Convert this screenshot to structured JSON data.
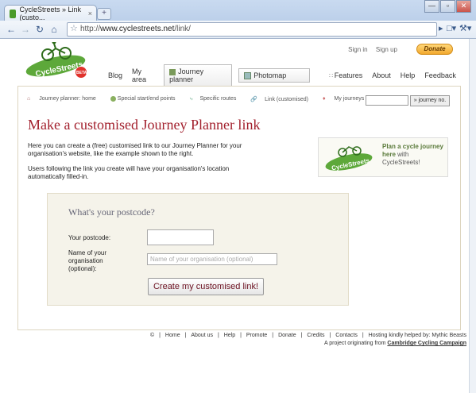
{
  "browser": {
    "tab_title": "CycleStreets » Link (custo...",
    "tab_close": "×",
    "new_tab": "+",
    "window_buttons": [
      "—",
      "▫",
      "✕"
    ],
    "url_prefix": "http://",
    "url_host": "www.cyclestreets.net",
    "url_path": "/link/"
  },
  "header": {
    "logo_text": "CycleStreets",
    "logo_badge": "BETA",
    "signin": "Sign in",
    "signup": "Sign up",
    "donate": "Donate",
    "nav": [
      "Blog",
      "My area",
      "Journey planner",
      "Photomap",
      "Features",
      "About",
      "Help",
      "Feedback"
    ]
  },
  "subnav": {
    "items": [
      "Journey planner: home",
      "Special start/end points",
      "Specific routes",
      "Link (customised)",
      "My journeys"
    ],
    "journey_button": "» journey no."
  },
  "main": {
    "title": "Make a customised Journey Planner link",
    "intro1": "Here you can create a (free) customised link to our Journey Planner for your organisation's website, like the example shown to the right.",
    "intro2": "Users following the link you create will have your organisation's location automatically filled-in.",
    "promo_bold": "Plan a cycle journey here",
    "promo_rest": " with CycleStreets!"
  },
  "form": {
    "heading": "What's your postcode?",
    "postcode_label": "Your postcode:",
    "postcode_value": "",
    "org_label": "Name of your organisation (optional):",
    "org_placeholder": "Name of your organisation (optional)",
    "submit_label": "Create my customised link!"
  },
  "footer": {
    "links": [
      "©",
      "|",
      "Home",
      "|",
      "About us",
      "|",
      "Help",
      "|",
      "Promote",
      "|",
      "Donate",
      "|",
      "Credits",
      "|",
      "Contacts",
      "|",
      "Hosting kindly helped by: Mythic Beasts"
    ],
    "origin_prefix": "A project originating from ",
    "origin_link": "Cambridge Cycling Campaign"
  }
}
